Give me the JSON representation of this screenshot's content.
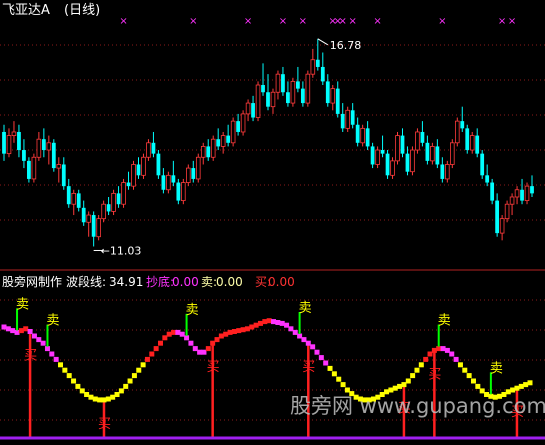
{
  "title": "飞亚达A",
  "period": "(日线)",
  "indicator": {
    "name": "股旁网制作",
    "fields": [
      {
        "label": "波段线:",
        "value": "34.91",
        "color": "#ffffff"
      },
      {
        "label": "抄底:",
        "value": "0.00",
        "color": "#ff33ff"
      },
      {
        "label": "卖:",
        "value": "0.00",
        "color": "#ffffaa"
      },
      {
        "label": "买:",
        "value": "0.00",
        "color": "#ff3333"
      }
    ]
  },
  "watermark": "股旁网  www.gupang.com",
  "colors": {
    "up": "#ff3b3b",
    "down": "#00ffff",
    "marker": "#ff33ff",
    "grid": "#8b1a1a",
    "axis": "#b22222",
    "band_red": "#ff2020",
    "band_magenta": "#ff33ff",
    "band_yellow": "#ffff00",
    "sell_flag": "#00ff00",
    "buy_bar": "#ff2020",
    "baseline": "#a020f0"
  },
  "chart_data": [
    {
      "type": "candlestick",
      "title": "飞亚达A (日线)",
      "annotations": [
        {
          "text": "16.78",
          "kind": "high",
          "candle_index": 63,
          "price": 16.78
        },
        {
          "text": "11.03",
          "kind": "low",
          "candle_index": 18,
          "price": 11.03
        }
      ],
      "ylim": [
        10.6,
        17.3
      ],
      "ohlc": [
        [
          14.2,
          14.4,
          13.4,
          13.6
        ],
        [
          13.6,
          14.3,
          13.5,
          14.1
        ],
        [
          14.1,
          14.5,
          13.9,
          14.2
        ],
        [
          14.2,
          14.4,
          13.5,
          13.7
        ],
        [
          13.7,
          14.0,
          13.2,
          13.4
        ],
        [
          13.4,
          13.5,
          12.8,
          12.9
        ],
        [
          12.9,
          13.6,
          12.8,
          13.5
        ],
        [
          13.5,
          14.2,
          13.4,
          14.0
        ],
        [
          14.0,
          14.3,
          13.5,
          13.7
        ],
        [
          13.7,
          14.1,
          13.3,
          13.9
        ],
        [
          13.9,
          14.0,
          13.1,
          13.2
        ],
        [
          13.2,
          13.5,
          12.8,
          13.3
        ],
        [
          13.3,
          13.5,
          12.6,
          12.7
        ],
        [
          12.7,
          12.9,
          12.1,
          12.2
        ],
        [
          12.2,
          12.6,
          11.9,
          12.5
        ],
        [
          12.5,
          12.6,
          12.0,
          12.1
        ],
        [
          12.1,
          12.3,
          11.6,
          11.7
        ],
        [
          11.7,
          12.0,
          11.3,
          11.9
        ],
        [
          11.9,
          12.0,
          11.03,
          11.3
        ],
        [
          11.3,
          11.9,
          11.2,
          11.8
        ],
        [
          11.8,
          12.3,
          11.7,
          12.2
        ],
        [
          12.2,
          12.4,
          11.9,
          12.0
        ],
        [
          12.0,
          12.6,
          11.9,
          12.5
        ],
        [
          12.5,
          12.7,
          12.1,
          12.2
        ],
        [
          12.2,
          12.9,
          12.1,
          12.8
        ],
        [
          12.8,
          13.1,
          12.6,
          12.7
        ],
        [
          12.7,
          13.4,
          12.6,
          13.3
        ],
        [
          13.3,
          13.5,
          12.9,
          13.0
        ],
        [
          13.0,
          13.6,
          12.9,
          13.5
        ],
        [
          13.5,
          14.0,
          13.4,
          13.9
        ],
        [
          13.9,
          14.2,
          13.5,
          13.6
        ],
        [
          13.6,
          13.7,
          12.9,
          13.0
        ],
        [
          13.0,
          13.2,
          12.5,
          12.6
        ],
        [
          12.6,
          13.1,
          12.5,
          13.0
        ],
        [
          13.0,
          13.4,
          12.7,
          12.8
        ],
        [
          12.8,
          12.9,
          12.2,
          12.3
        ],
        [
          12.3,
          12.9,
          12.2,
          12.8
        ],
        [
          12.8,
          13.3,
          12.7,
          13.2
        ],
        [
          13.2,
          13.4,
          12.8,
          12.9
        ],
        [
          12.9,
          13.6,
          12.8,
          13.5
        ],
        [
          13.5,
          13.9,
          13.3,
          13.8
        ],
        [
          13.8,
          14.0,
          13.4,
          13.5
        ],
        [
          13.5,
          14.1,
          13.4,
          14.0
        ],
        [
          14.0,
          14.3,
          13.7,
          13.8
        ],
        [
          13.8,
          14.2,
          13.6,
          14.1
        ],
        [
          14.1,
          14.4,
          13.8,
          13.9
        ],
        [
          13.9,
          14.6,
          13.8,
          14.5
        ],
        [
          14.5,
          14.7,
          14.1,
          14.2
        ],
        [
          14.2,
          14.8,
          14.1,
          14.7
        ],
        [
          14.7,
          15.1,
          14.5,
          15.0
        ],
        [
          15.0,
          15.2,
          14.5,
          14.6
        ],
        [
          14.6,
          15.6,
          14.5,
          15.5
        ],
        [
          15.5,
          16.1,
          15.2,
          15.3
        ],
        [
          15.3,
          15.8,
          14.8,
          14.9
        ],
        [
          14.9,
          15.4,
          14.7,
          15.3
        ],
        [
          15.3,
          15.9,
          15.1,
          15.8
        ],
        [
          15.8,
          16.0,
          15.2,
          15.3
        ],
        [
          15.3,
          15.6,
          14.9,
          15.0
        ],
        [
          15.0,
          15.7,
          14.9,
          15.6
        ],
        [
          15.6,
          16.0,
          15.3,
          15.4
        ],
        [
          15.4,
          15.6,
          14.9,
          15.0
        ],
        [
          15.0,
          15.9,
          14.9,
          15.8
        ],
        [
          15.8,
          16.5,
          15.7,
          16.2
        ],
        [
          16.2,
          16.78,
          15.9,
          16.0
        ],
        [
          16.0,
          16.4,
          15.5,
          15.6
        ],
        [
          15.6,
          15.8,
          14.9,
          15.0
        ],
        [
          15.0,
          15.5,
          14.8,
          15.4
        ],
        [
          15.4,
          15.6,
          14.6,
          14.7
        ],
        [
          14.7,
          15.0,
          14.2,
          14.3
        ],
        [
          14.3,
          14.9,
          14.2,
          14.8
        ],
        [
          14.8,
          15.0,
          14.3,
          14.4
        ],
        [
          14.4,
          14.6,
          13.8,
          13.9
        ],
        [
          13.9,
          14.4,
          13.8,
          14.3
        ],
        [
          14.3,
          14.5,
          13.7,
          13.8
        ],
        [
          13.8,
          13.9,
          13.2,
          13.3
        ],
        [
          13.3,
          13.8,
          13.2,
          13.7
        ],
        [
          13.7,
          14.1,
          13.5,
          13.6
        ],
        [
          13.6,
          13.7,
          12.9,
          13.0
        ],
        [
          13.0,
          13.5,
          12.9,
          13.4
        ],
        [
          13.4,
          14.2,
          13.3,
          14.1
        ],
        [
          14.1,
          14.3,
          13.5,
          13.6
        ],
        [
          13.6,
          13.8,
          13.0,
          13.1
        ],
        [
          13.1,
          13.8,
          13.0,
          13.7
        ],
        [
          13.7,
          14.3,
          13.6,
          14.2
        ],
        [
          14.2,
          14.5,
          13.8,
          13.9
        ],
        [
          13.9,
          14.1,
          13.3,
          13.4
        ],
        [
          13.4,
          13.9,
          13.3,
          13.8
        ],
        [
          13.8,
          14.0,
          13.2,
          13.3
        ],
        [
          13.3,
          13.5,
          12.8,
          12.9
        ],
        [
          12.9,
          13.4,
          12.8,
          13.3
        ],
        [
          13.3,
          14.0,
          13.2,
          13.9
        ],
        [
          13.9,
          14.6,
          13.8,
          14.5
        ],
        [
          14.5,
          14.9,
          14.2,
          14.3
        ],
        [
          14.3,
          14.4,
          13.6,
          13.7
        ],
        [
          13.7,
          14.2,
          13.6,
          14.1
        ],
        [
          14.1,
          14.3,
          13.5,
          13.6
        ],
        [
          13.6,
          13.7,
          12.9,
          13.0
        ],
        [
          13.0,
          13.3,
          12.7,
          12.8
        ],
        [
          12.8,
          12.9,
          12.2,
          12.3
        ],
        [
          12.3,
          12.5,
          11.3,
          11.4
        ],
        [
          11.4,
          11.9,
          11.2,
          11.8
        ],
        [
          11.8,
          12.3,
          11.7,
          12.2
        ],
        [
          12.2,
          12.5,
          11.9,
          12.4
        ],
        [
          12.4,
          12.7,
          12.2,
          12.6
        ],
        [
          12.6,
          12.9,
          12.2,
          12.3
        ],
        [
          12.3,
          12.8,
          12.2,
          12.7
        ],
        [
          12.7,
          13.0,
          12.4,
          12.5
        ]
      ],
      "top_markers": [
        24,
        38,
        49,
        56,
        60,
        66,
        67,
        68,
        70,
        75,
        88,
        100,
        102,
        110,
        117,
        124
      ]
    },
    {
      "type": "line",
      "title": "股旁网制作",
      "ylim": [
        0,
        100
      ],
      "series": [
        {
          "name": "波段线",
          "values": [
            90,
            88,
            86,
            84,
            86,
            88,
            85,
            80,
            76,
            72,
            66,
            60,
            54,
            48,
            42,
            36,
            30,
            24,
            19,
            15,
            12,
            10,
            9,
            9,
            10,
            12,
            15,
            19,
            24,
            30,
            36,
            42,
            48,
            54,
            60,
            66,
            72,
            78,
            82,
            84,
            84,
            82,
            78,
            72,
            66,
            62,
            62,
            66,
            72,
            76,
            80,
            82,
            84,
            85,
            86,
            87,
            88,
            90,
            92,
            94,
            96,
            97,
            96,
            95,
            94,
            92,
            88,
            84,
            80,
            76,
            72,
            68,
            62,
            56,
            50,
            44,
            38,
            32,
            26,
            20,
            16,
            12,
            10,
            9,
            9,
            10,
            12,
            15,
            18,
            20,
            22,
            24,
            26,
            30,
            36,
            42,
            48,
            54,
            60,
            64,
            66,
            66,
            64,
            60,
            54,
            48,
            42,
            36,
            30,
            24,
            19,
            15,
            13,
            12,
            13,
            15,
            18,
            20,
            22,
            24,
            26,
            28
          ]
        }
      ],
      "sell_signals": [
        3,
        10,
        42,
        68,
        100,
        112
      ],
      "buy_signals": [
        6,
        23,
        48,
        70,
        92,
        99,
        118
      ]
    }
  ]
}
